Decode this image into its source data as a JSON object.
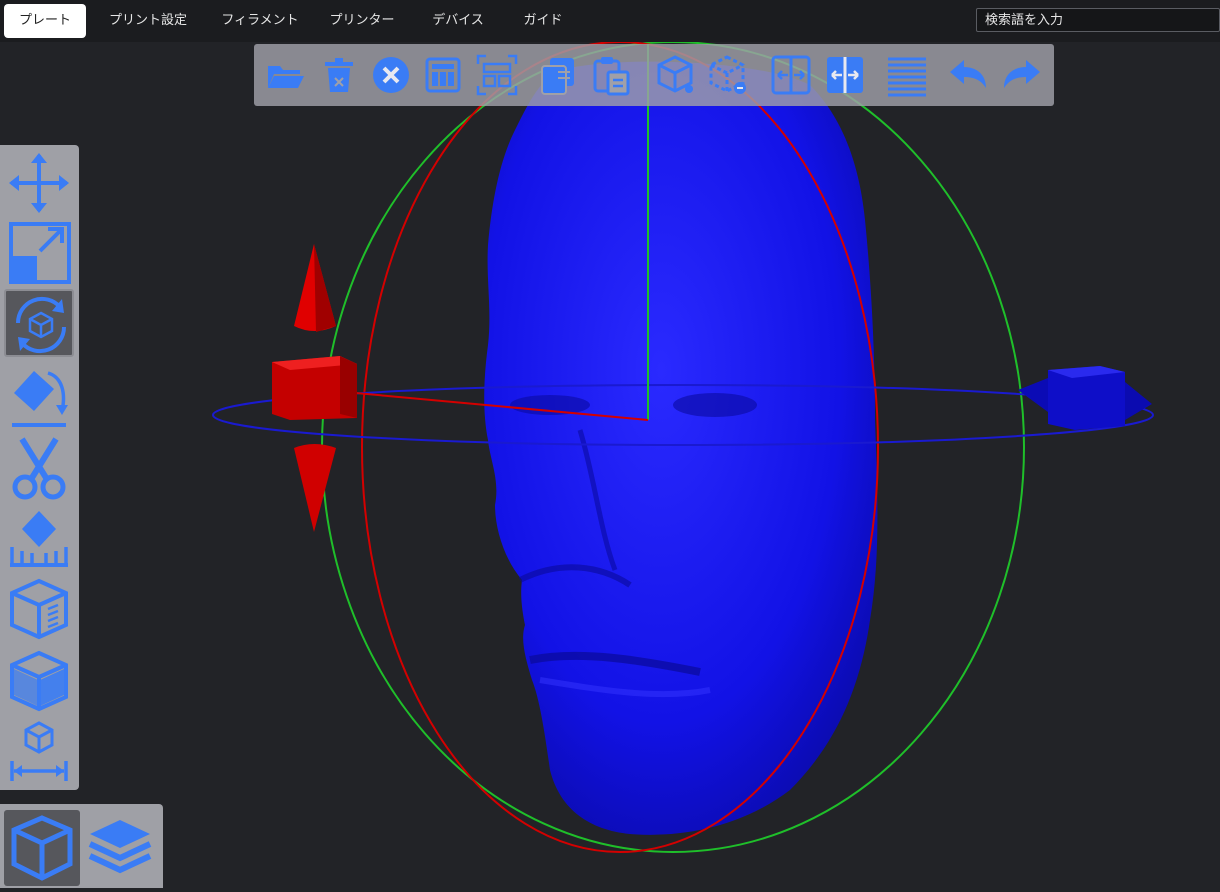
{
  "menu": {
    "tabs": [
      {
        "label": "プレート",
        "active": true
      },
      {
        "label": "プリント設定",
        "active": false
      },
      {
        "label": "フィラメント",
        "active": false
      },
      {
        "label": "プリンター",
        "active": false
      },
      {
        "label": "デバイス",
        "active": false
      },
      {
        "label": "ガイド",
        "active": false
      }
    ],
    "search_placeholder": "検索語を入力"
  },
  "toolbar": {
    "icons": [
      "open-folder-icon",
      "delete-icon",
      "delete-all-icon",
      "arrange-icon",
      "arrange-selection-icon",
      "copy-icon",
      "paste-icon",
      "add-part-icon",
      "delete-part-icon",
      "split-objects-icon",
      "split-parts-icon",
      "layers-editor-icon",
      "undo-icon",
      "redo-icon"
    ]
  },
  "left_tools": {
    "icons": [
      "move-icon",
      "scale-icon",
      "rotate-icon",
      "place-on-face-icon",
      "cut-icon",
      "support-paint-icon",
      "seam-paint-icon",
      "color-paint-icon",
      "measure-icon"
    ],
    "active": "rotate-icon"
  },
  "view_tabs": {
    "icons": [
      "3d-view-icon",
      "layer-view-icon"
    ],
    "active": "3d-view-icon"
  },
  "colors": {
    "accent": "#3a7cf5",
    "model": "#1212e6",
    "gizmo_red": "#d40000",
    "gizmo_green": "#1fbf2a",
    "gizmo_blue": "#1a1ad0"
  }
}
